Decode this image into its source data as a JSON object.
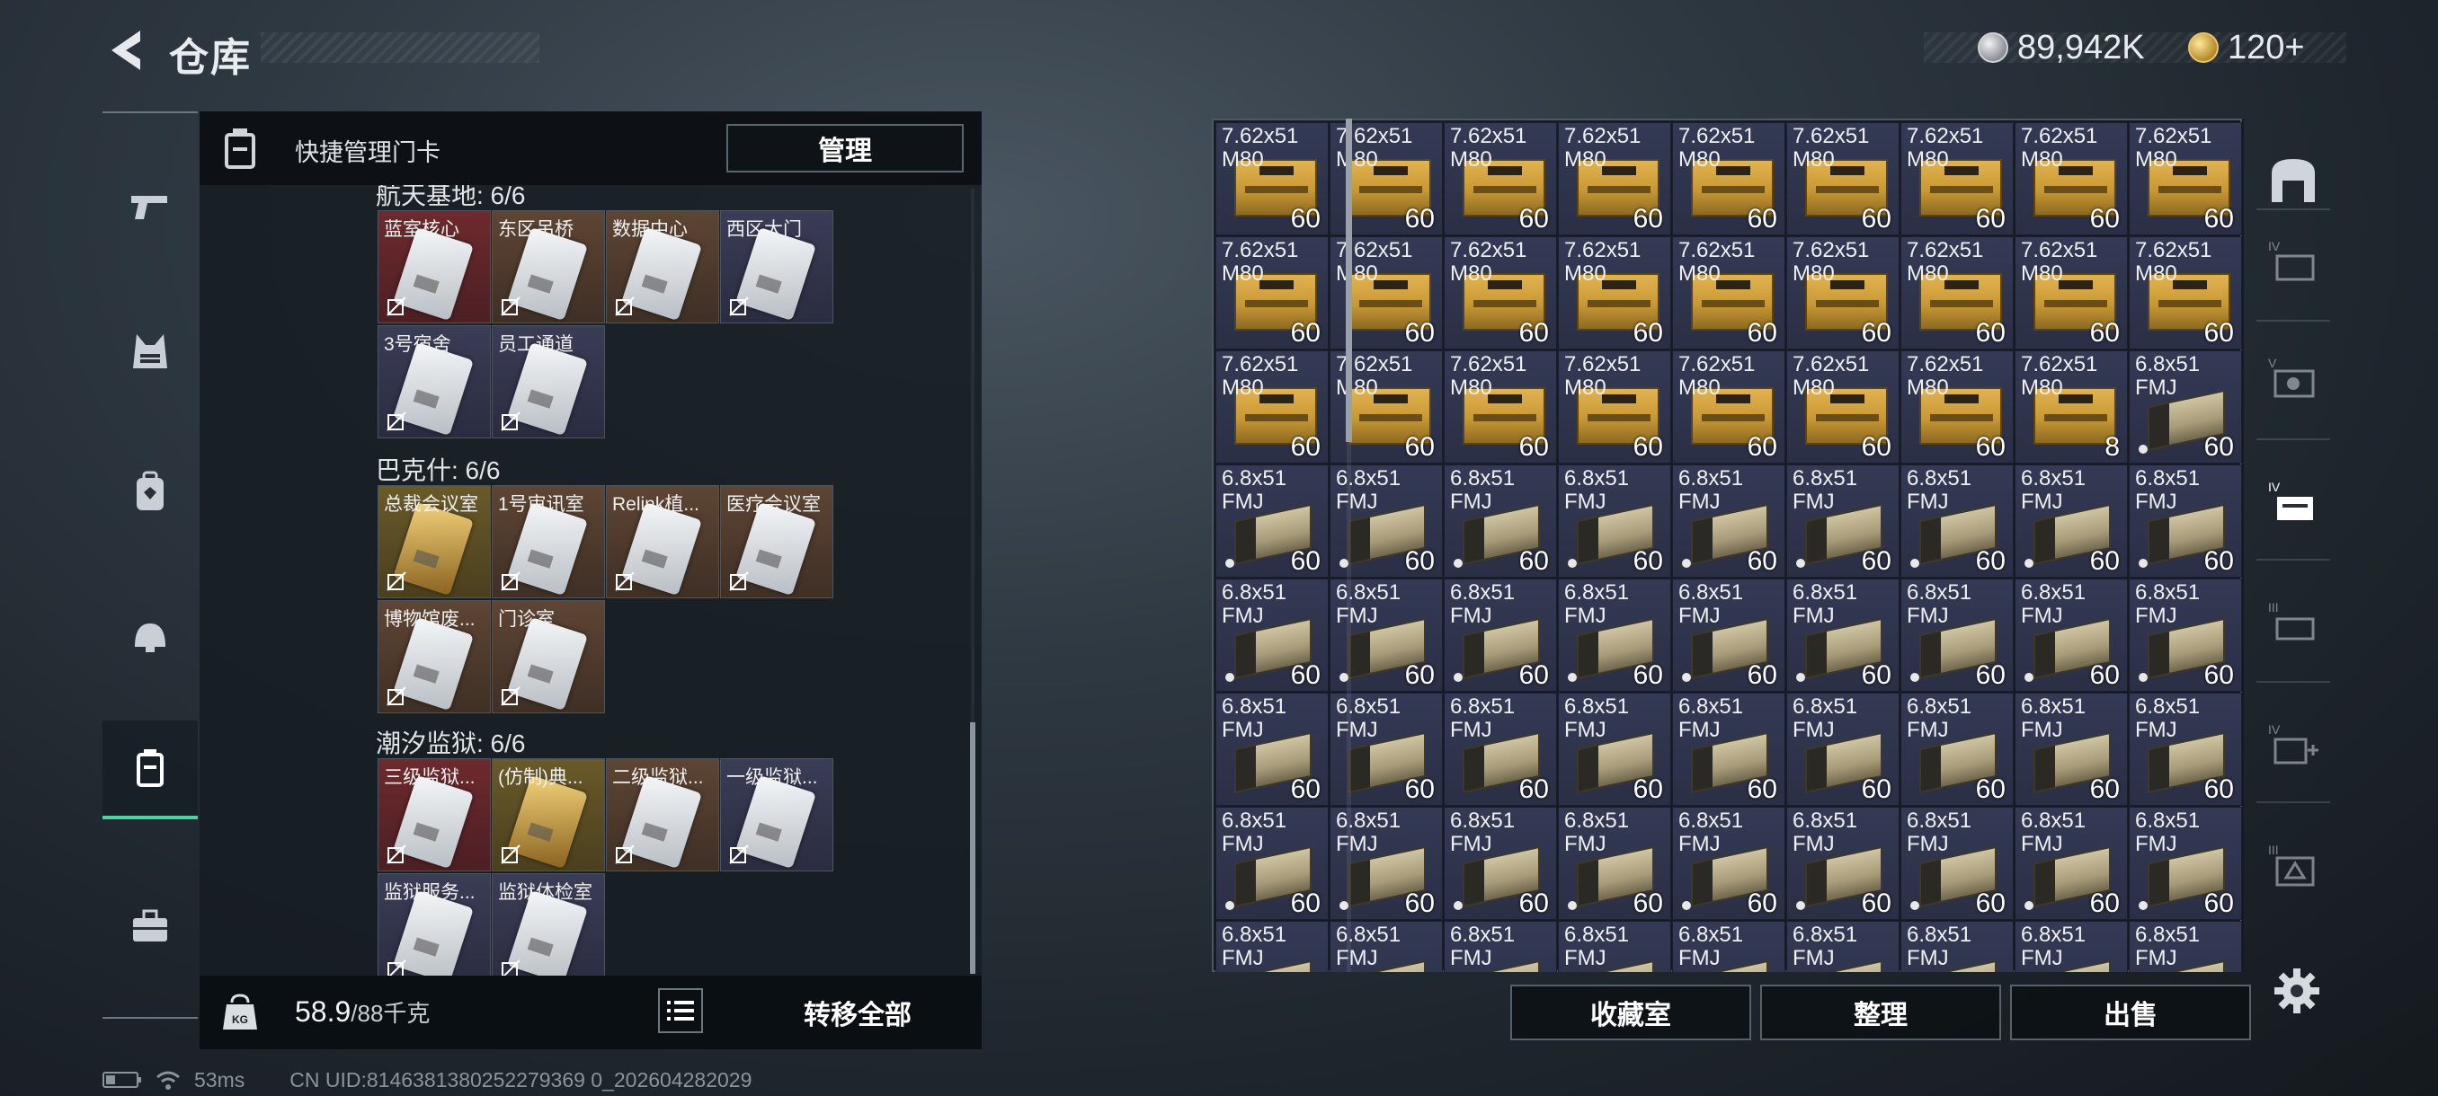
{
  "header": {
    "title": "仓库",
    "currency_silver": "89,942K",
    "currency_gold": "120+"
  },
  "left_panel": {
    "header_label": "快捷管理门卡",
    "manage_label": "管理",
    "sections": [
      {
        "title": "航天基地: 6/6",
        "cards": [
          {
            "name": "蓝室核心",
            "color": "red"
          },
          {
            "name": "东区吊桥",
            "color": "brown"
          },
          {
            "name": "数据中心",
            "color": "brown"
          },
          {
            "name": "西区大门",
            "color": "navy"
          },
          {
            "name": "3号宿舍",
            "color": "navy"
          },
          {
            "name": "员工通道",
            "color": "navy"
          }
        ]
      },
      {
        "title": "巴克什: 6/6",
        "cards": [
          {
            "name": "总裁会议室",
            "color": "gold"
          },
          {
            "name": "1号审讯室",
            "color": "brown"
          },
          {
            "name": "Relink植...",
            "color": "brown"
          },
          {
            "name": "医疗会议室",
            "color": "brown"
          },
          {
            "name": "博物馆废...",
            "color": "brown"
          },
          {
            "name": "门诊室",
            "color": "brown"
          }
        ]
      },
      {
        "title": "潮汐监狱: 6/6",
        "cards": [
          {
            "name": "三级监狱...",
            "color": "red"
          },
          {
            "name": "(仿制)典...",
            "color": "gold"
          },
          {
            "name": "二级监狱...",
            "color": "brown"
          },
          {
            "name": "一级监狱...",
            "color": "navy"
          },
          {
            "name": "监狱服务...",
            "color": "navy"
          },
          {
            "name": "监狱体检室",
            "color": "navy"
          }
        ]
      }
    ],
    "weight_current": "58.9",
    "weight_max": "/88千克",
    "transfer_all_label": "转移全部"
  },
  "stash": {
    "columns": 9,
    "items": [
      {
        "name": "7.62x51 M80",
        "count": "60",
        "type": "762",
        "dot": false
      },
      {
        "name": "7.62x51 M80",
        "count": "60",
        "type": "762",
        "dot": false
      },
      {
        "name": "7.62x51 M80",
        "count": "60",
        "type": "762",
        "dot": false
      },
      {
        "name": "7.62x51 M80",
        "count": "60",
        "type": "762",
        "dot": false
      },
      {
        "name": "7.62x51 M80",
        "count": "60",
        "type": "762",
        "dot": false
      },
      {
        "name": "7.62x51 M80",
        "count": "60",
        "type": "762",
        "dot": false
      },
      {
        "name": "7.62x51 M80",
        "count": "60",
        "type": "762",
        "dot": false
      },
      {
        "name": "7.62x51 M80",
        "count": "60",
        "type": "762",
        "dot": false
      },
      {
        "name": "7.62x51 M80",
        "count": "60",
        "type": "762",
        "dot": false
      },
      {
        "name": "7.62x51 M80",
        "count": "60",
        "type": "762",
        "dot": false
      },
      {
        "name": "7.62x51 M80",
        "count": "60",
        "type": "762",
        "dot": false
      },
      {
        "name": "7.62x51 M80",
        "count": "60",
        "type": "762",
        "dot": false
      },
      {
        "name": "7.62x51 M80",
        "count": "60",
        "type": "762",
        "dot": false
      },
      {
        "name": "7.62x51 M80",
        "count": "60",
        "type": "762",
        "dot": false
      },
      {
        "name": "7.62x51 M80",
        "count": "60",
        "type": "762",
        "dot": false
      },
      {
        "name": "7.62x51 M80",
        "count": "60",
        "type": "762",
        "dot": false
      },
      {
        "name": "7.62x51 M80",
        "count": "60",
        "type": "762",
        "dot": false
      },
      {
        "name": "7.62x51 M80",
        "count": "60",
        "type": "762",
        "dot": false
      },
      {
        "name": "7.62x51 M80",
        "count": "60",
        "type": "762",
        "dot": false
      },
      {
        "name": "7.62x51 M80",
        "count": "60",
        "type": "762",
        "dot": false
      },
      {
        "name": "7.62x51 M80",
        "count": "60",
        "type": "762",
        "dot": false
      },
      {
        "name": "7.62x51 M80",
        "count": "60",
        "type": "762",
        "dot": false
      },
      {
        "name": "7.62x51 M80",
        "count": "60",
        "type": "762",
        "dot": false
      },
      {
        "name": "7.62x51 M80",
        "count": "60",
        "type": "762",
        "dot": false
      },
      {
        "name": "7.62x51 M80",
        "count": "60",
        "type": "762",
        "dot": false
      },
      {
        "name": "7.62x51 M80",
        "count": "8",
        "type": "762",
        "dot": false
      },
      {
        "name": "6.8x51 FMJ",
        "count": "60",
        "type": "68",
        "dot": true
      },
      {
        "name": "6.8x51 FMJ",
        "count": "60",
        "type": "68",
        "dot": true
      },
      {
        "name": "6.8x51 FMJ",
        "count": "60",
        "type": "68",
        "dot": true
      },
      {
        "name": "6.8x51 FMJ",
        "count": "60",
        "type": "68",
        "dot": true
      },
      {
        "name": "6.8x51 FMJ",
        "count": "60",
        "type": "68",
        "dot": true
      },
      {
        "name": "6.8x51 FMJ",
        "count": "60",
        "type": "68",
        "dot": true
      },
      {
        "name": "6.8x51 FMJ",
        "count": "60",
        "type": "68",
        "dot": true
      },
      {
        "name": "6.8x51 FMJ",
        "count": "60",
        "type": "68",
        "dot": true
      },
      {
        "name": "6.8x51 FMJ",
        "count": "60",
        "type": "68",
        "dot": true
      },
      {
        "name": "6.8x51 FMJ",
        "count": "60",
        "type": "68",
        "dot": true
      },
      {
        "name": "6.8x51 FMJ",
        "count": "60",
        "type": "68",
        "dot": true
      },
      {
        "name": "6.8x51 FMJ",
        "count": "60",
        "type": "68",
        "dot": true
      },
      {
        "name": "6.8x51 FMJ",
        "count": "60",
        "type": "68",
        "dot": true
      },
      {
        "name": "6.8x51 FMJ",
        "count": "60",
        "type": "68",
        "dot": true
      },
      {
        "name": "6.8x51 FMJ",
        "count": "60",
        "type": "68",
        "dot": true
      },
      {
        "name": "6.8x51 FMJ",
        "count": "60",
        "type": "68",
        "dot": true
      },
      {
        "name": "6.8x51 FMJ",
        "count": "60",
        "type": "68",
        "dot": true
      },
      {
        "name": "6.8x51 FMJ",
        "count": "60",
        "type": "68",
        "dot": true
      },
      {
        "name": "6.8x51 FMJ",
        "count": "60",
        "type": "68",
        "dot": true
      },
      {
        "name": "6.8x51 FMJ",
        "count": "60",
        "type": "68",
        "dot": false
      },
      {
        "name": "6.8x51 FMJ",
        "count": "60",
        "type": "68",
        "dot": false
      },
      {
        "name": "6.8x51 FMJ",
        "count": "60",
        "type": "68",
        "dot": false
      },
      {
        "name": "6.8x51 FMJ",
        "count": "60",
        "type": "68",
        "dot": false
      },
      {
        "name": "6.8x51 FMJ",
        "count": "60",
        "type": "68",
        "dot": false
      },
      {
        "name": "6.8x51 FMJ",
        "count": "60",
        "type": "68",
        "dot": false
      },
      {
        "name": "6.8x51 FMJ",
        "count": "60",
        "type": "68",
        "dot": false
      },
      {
        "name": "6.8x51 FMJ",
        "count": "60",
        "type": "68",
        "dot": false
      },
      {
        "name": "6.8x51 FMJ",
        "count": "60",
        "type": "68",
        "dot": false
      },
      {
        "name": "6.8x51 FMJ",
        "count": "60",
        "type": "68",
        "dot": true
      },
      {
        "name": "6.8x51 FMJ",
        "count": "60",
        "type": "68",
        "dot": true
      },
      {
        "name": "6.8x51 FMJ",
        "count": "60",
        "type": "68",
        "dot": true
      },
      {
        "name": "6.8x51 FMJ",
        "count": "60",
        "type": "68",
        "dot": true
      },
      {
        "name": "6.8x51 FMJ",
        "count": "60",
        "type": "68",
        "dot": true
      },
      {
        "name": "6.8x51 FMJ",
        "count": "60",
        "type": "68",
        "dot": true
      },
      {
        "name": "6.8x51 FMJ",
        "count": "60",
        "type": "68",
        "dot": true
      },
      {
        "name": "6.8x51 FMJ",
        "count": "60",
        "type": "68",
        "dot": true
      },
      {
        "name": "6.8x51 FMJ",
        "count": "60",
        "type": "68",
        "dot": true
      },
      {
        "name": "6.8x51 FMJ",
        "count": "",
        "type": "68",
        "dot": false
      },
      {
        "name": "6.8x51 FMJ",
        "count": "",
        "type": "68",
        "dot": false
      },
      {
        "name": "6.8x51 FMJ",
        "count": "",
        "type": "68",
        "dot": false
      },
      {
        "name": "6.8x51 FMJ",
        "count": "",
        "type": "68",
        "dot": false
      },
      {
        "name": "6.8x51 FMJ",
        "count": "",
        "type": "68",
        "dot": false
      },
      {
        "name": "6.8x51 FMJ",
        "count": "",
        "type": "68",
        "dot": false
      },
      {
        "name": "6.8x51 FMJ",
        "count": "",
        "type": "68",
        "dot": false
      },
      {
        "name": "6.8x51 FMJ",
        "count": "",
        "type": "68",
        "dot": false
      },
      {
        "name": "6.8x51 FMJ",
        "count": "",
        "type": "68",
        "dot": false
      }
    ],
    "buttons": {
      "collection": "收藏室",
      "sort": "整理",
      "sell": "出售"
    }
  },
  "status_bar": {
    "ping": "53ms",
    "uid": "CN UID:8146381380252279369 0_202604282029"
  },
  "colors": {
    "accent_active": "#4fd1a0",
    "gold": "#e6c46a"
  },
  "icons": {
    "left_nav": [
      "pistol-icon",
      "vest-icon",
      "backpack-icon",
      "helmet-icon",
      "keycard-case-icon",
      "toolbox-icon"
    ],
    "right_tabs": [
      "bunker-icon",
      "tier-4-crate-icon",
      "tier-5-safe-icon",
      "tier-4-case-icon",
      "tier-3-case-icon",
      "tier-4-medkit-icon",
      "tier-3-crate-icon"
    ]
  }
}
